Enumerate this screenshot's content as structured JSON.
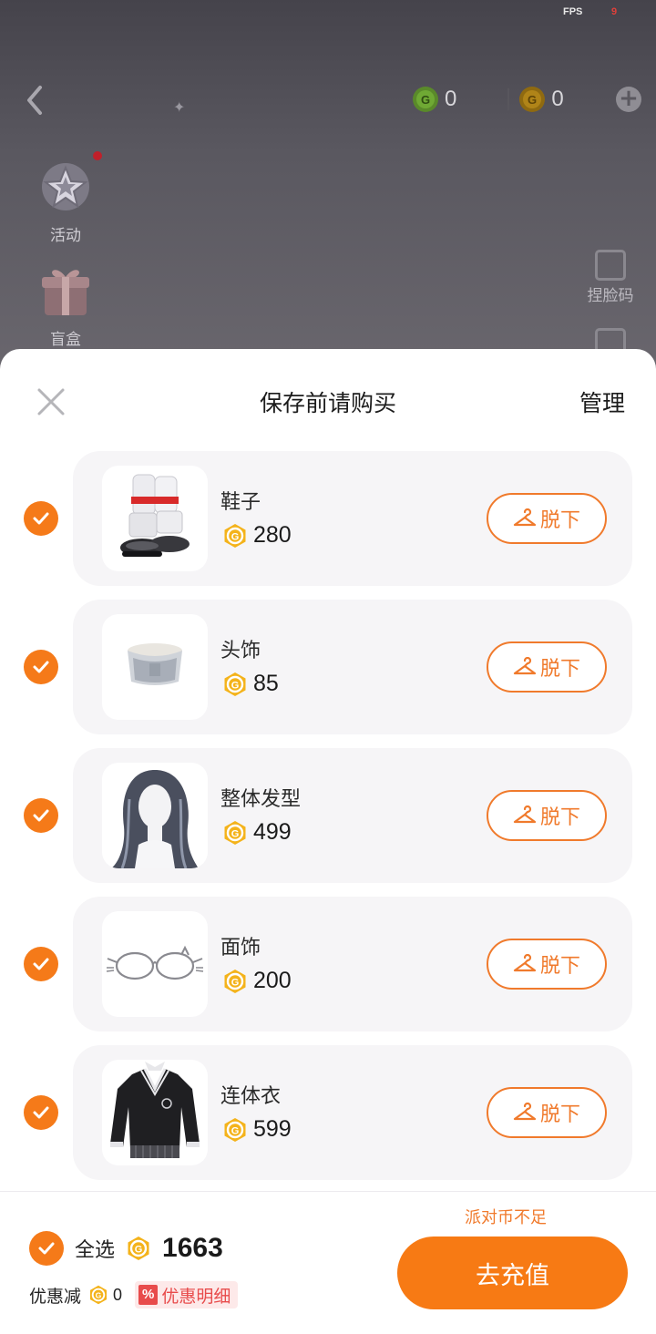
{
  "status": {
    "fps_label": "FPS",
    "fps_value": "9"
  },
  "currency": {
    "green_coin": "0",
    "gold_coin": "0"
  },
  "sidebar_left": [
    {
      "label": "活动",
      "icon": "star-badge-icon"
    },
    {
      "label": "盲盒",
      "icon": "gift-box-icon"
    }
  ],
  "sidebar_right": [
    {
      "label": "捏脸码",
      "icon": "edit-code-icon"
    }
  ],
  "sheet": {
    "title": "保存前请购买",
    "manage_label": "管理",
    "remove_label": "脱下",
    "items": [
      {
        "name": "鞋子",
        "price": "280",
        "icon": "shoes-thumbnail"
      },
      {
        "name": "头饰",
        "price": "85",
        "icon": "headwear-thumbnail"
      },
      {
        "name": "整体发型",
        "price": "499",
        "icon": "hairstyle-thumbnail"
      },
      {
        "name": "面饰",
        "price": "200",
        "icon": "glasses-thumbnail"
      },
      {
        "name": "连体衣",
        "price": "599",
        "icon": "sweater-dress-thumbnail"
      }
    ]
  },
  "footer": {
    "insufficient_text": "派对币不足",
    "select_all_label": "全选",
    "total": "1663",
    "discount_label": "优惠减",
    "discount_value": "0",
    "discount_badge": "%",
    "discount_detail_label": "优惠明细",
    "recharge_label": "去充值"
  },
  "colors": {
    "accent": "#f57a19",
    "coin_gold": "#f4b31b",
    "discount_red": "#e84b4b"
  }
}
